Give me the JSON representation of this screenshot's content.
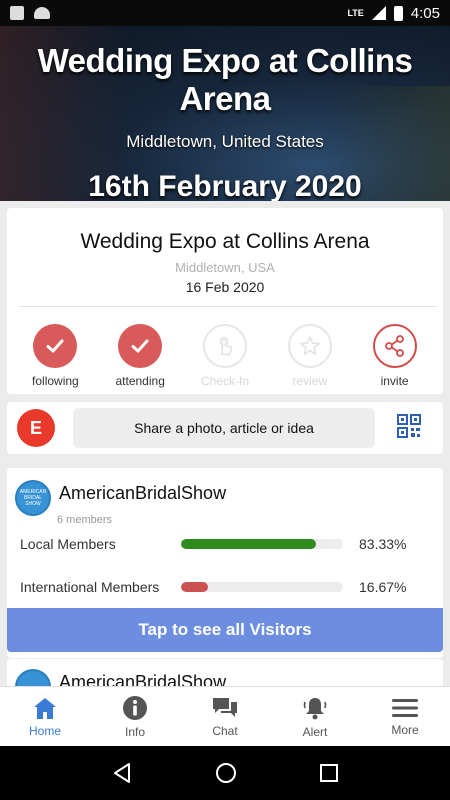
{
  "status_bar": {
    "network": "LTE",
    "time": "4:05"
  },
  "banner": {
    "title": "Wedding Expo at Collins Arena",
    "location": "Middletown, United States",
    "date": "16th February 2020"
  },
  "event": {
    "title": "Wedding Expo at Collins Arena",
    "location": "Middletown, USA",
    "date": "16 Feb 2020",
    "actions": [
      {
        "label": "following",
        "state": "active",
        "icon": "check-icon"
      },
      {
        "label": "attending",
        "state": "active",
        "icon": "check-icon"
      },
      {
        "label": "Check-In",
        "state": "disabled",
        "icon": "hand-pointer-icon"
      },
      {
        "label": "review",
        "state": "disabled",
        "icon": "star-icon"
      },
      {
        "label": "invite",
        "state": "outline",
        "icon": "share-icon"
      }
    ]
  },
  "composer": {
    "avatar_letter": "E",
    "prompt": "Share a photo, article or idea"
  },
  "group": {
    "name": "AmericanBridalShow",
    "logo_text": "AMERICAN BRIDAL SHOW",
    "members": "6 members",
    "stats": [
      {
        "label": "Local Members",
        "percent_text": "83.33%",
        "value": 0.8333,
        "color": "#2e8b1e"
      },
      {
        "label": "International Members",
        "percent_text": "16.67%",
        "value": 0.1667,
        "color": "#cc5252"
      }
    ],
    "cta": "Tap to see all Visitors"
  },
  "group2": {
    "name": "AmericanBridalShow"
  },
  "nav": {
    "items": [
      {
        "label": "Home",
        "icon": "home-icon",
        "active": true
      },
      {
        "label": "Info",
        "icon": "info-icon",
        "active": false
      },
      {
        "label": "Chat",
        "icon": "chat-icon",
        "active": false
      },
      {
        "label": "Alert",
        "icon": "bell-icon",
        "active": false
      },
      {
        "label": "More",
        "icon": "menu-icon",
        "active": false
      }
    ]
  },
  "colors": {
    "accent_red": "#d95a5a",
    "nav_active": "#3a7bd5",
    "cta_blue": "#6d8ee0"
  }
}
